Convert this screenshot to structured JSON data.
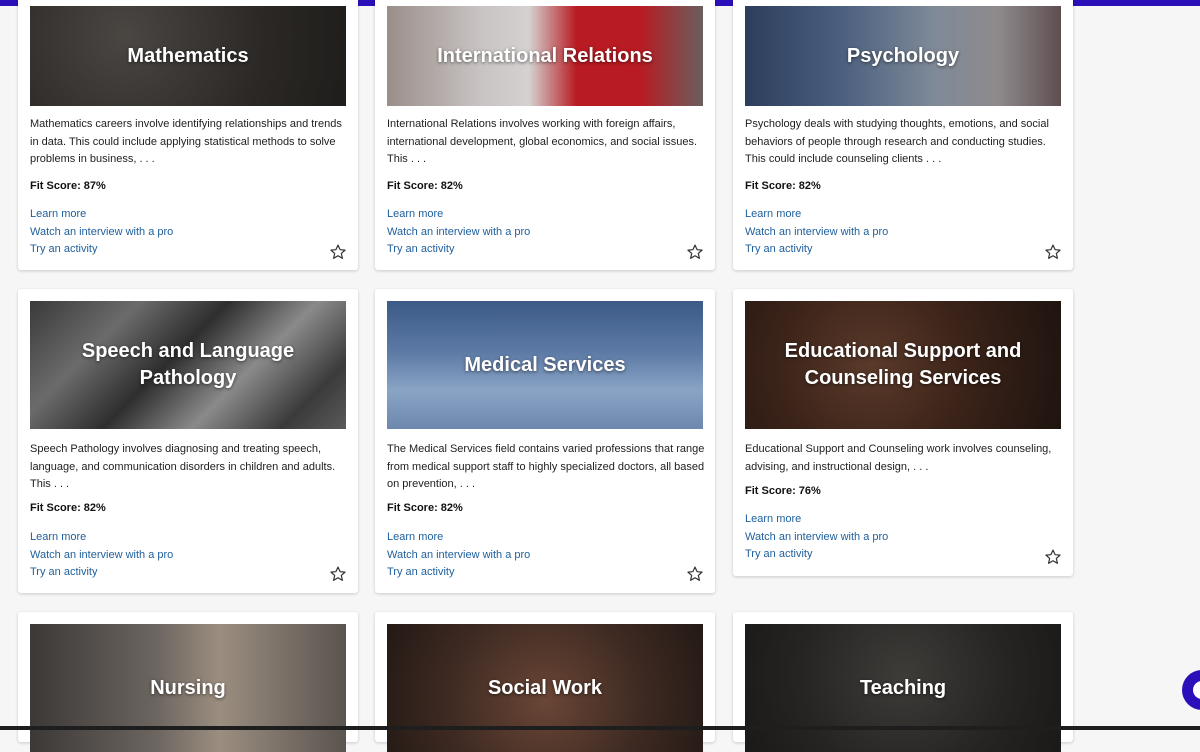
{
  "labels": {
    "fit_prefix": "Fit Score:",
    "learn_more": "Learn more",
    "watch_interview": "Watch an interview with a pro",
    "try_activity": "Try an activity",
    "favorite_icon": "star-outline-icon",
    "chat_icon": "chat-bubble-icon"
  },
  "colors": {
    "brand": "#2b0fb8",
    "link": "#1f5f9c",
    "page_bg": "#f6f6f7"
  },
  "cards": [
    {
      "title": "Mathematics",
      "description": "Mathematics careers involve identifying relationships and trends in data. This could include applying statistical methods to solve problems in business, . . .",
      "fit_score": "Fit Score: 87%"
    },
    {
      "title": "International Relations",
      "description": "International Relations involves working with foreign affairs, international development, global economics, and social issues. This . . .",
      "fit_score": "Fit Score: 82%"
    },
    {
      "title": "Psychology",
      "description": "Psychology deals with studying thoughts, emotions, and social behaviors of people through research and conducting studies. This could include counseling clients . . .",
      "fit_score": "Fit Score: 82%"
    },
    {
      "title": "Speech and Language Pathology",
      "description": "Speech Pathology involves diagnosing and treating speech, language, and communication disorders in children and adults. This . . .",
      "fit_score": "Fit Score: 82%"
    },
    {
      "title": "Medical Services",
      "description": "The Medical Services field contains varied professions that range from medical support staff to highly specialized doctors, all based on prevention, . . .",
      "fit_score": "Fit Score: 82%"
    },
    {
      "title": "Educational Support and Counseling Services",
      "description": "Educational Support and Counseling work involves counseling, advising, and instructional design, . . .",
      "fit_score": "Fit Score: 76%"
    },
    {
      "title": "Nursing"
    },
    {
      "title": "Social Work"
    },
    {
      "title": "Teaching"
    }
  ]
}
